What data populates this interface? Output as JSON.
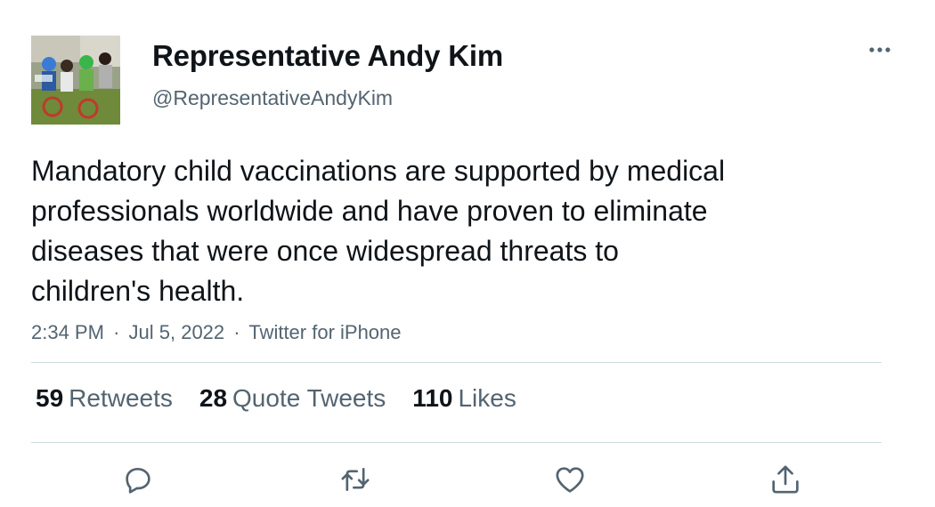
{
  "author": {
    "display_name": "Representative Andy Kim",
    "handle": "@RepresentativeAndyKim",
    "avatar_icon": "avatar-photo"
  },
  "tweet": {
    "text_lines": [
      "Mandatory child vaccinations are supported by medical",
      "professionals worldwide and have proven to eliminate",
      "diseases that were once widespread threats to",
      "children's health."
    ],
    "time": "2:34 PM",
    "date": "Jul 5, 2022",
    "source": "Twitter for iPhone",
    "separator": "·"
  },
  "stats": {
    "retweets": {
      "count": "59",
      "label": "Retweets"
    },
    "quote_tweets": {
      "count": "28",
      "label": "Quote Tweets"
    },
    "likes": {
      "count": "110",
      "label": "Likes"
    }
  },
  "actions": {
    "reply_icon": "reply-icon",
    "retweet_icon": "retweet-icon",
    "like_icon": "heart-icon",
    "share_icon": "share-icon"
  },
  "colors": {
    "text_primary": "#0f1419",
    "text_secondary": "#536471",
    "divider": "#cfd9de"
  }
}
